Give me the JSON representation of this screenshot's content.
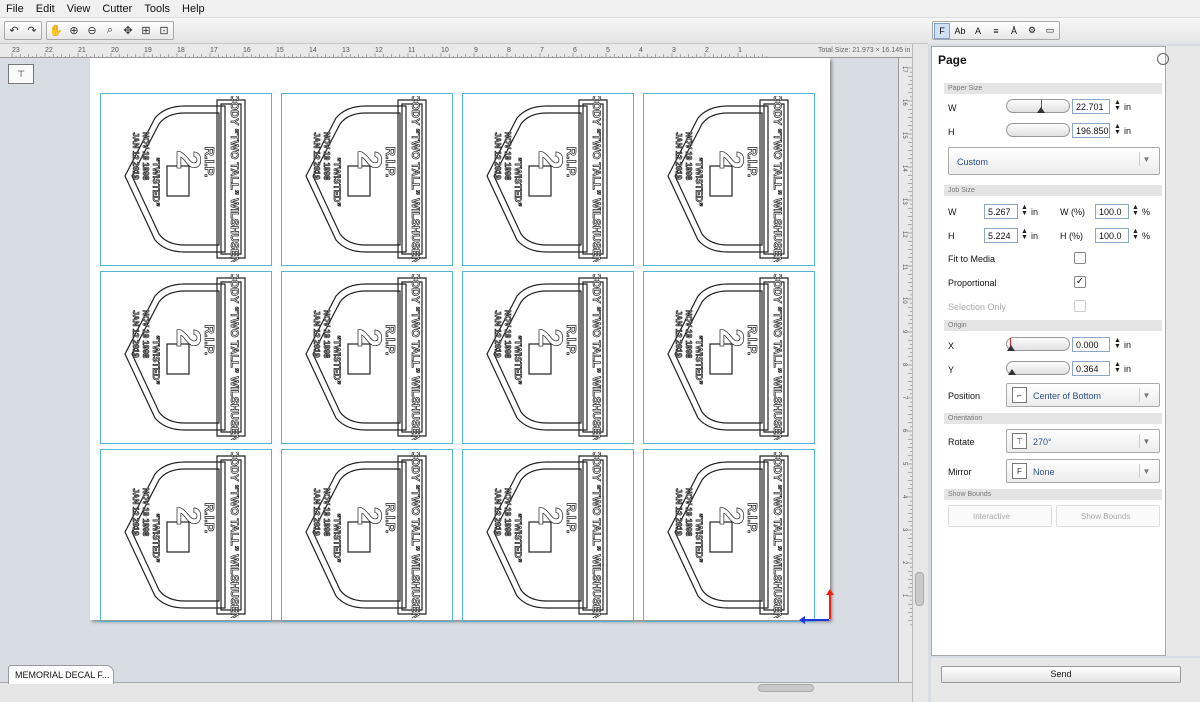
{
  "menu": [
    "File",
    "Edit",
    "View",
    "Cutter",
    "Tools",
    "Help"
  ],
  "toolbar": {
    "undo_redo": [
      "undo-icon",
      "redo-icon"
    ],
    "tools": [
      "hand-icon",
      "zoom-in-icon",
      "zoom-out-icon",
      "zoom-area-icon",
      "pan-icon",
      "fit-page-icon",
      "fit-selection-icon"
    ]
  },
  "ruler": {
    "labels": [
      "23",
      "22",
      "21",
      "20",
      "19",
      "18",
      "17",
      "16",
      "15",
      "14",
      "13",
      "12",
      "11",
      "10",
      "9",
      "8",
      "7",
      "6",
      "5",
      "4",
      "3",
      "2",
      "1"
    ],
    "total_size": "Total Size: 21.973 × 16.145 in",
    "vlabels": [
      "17",
      "16",
      "15",
      "14",
      "13",
      "12",
      "11",
      "10",
      "9",
      "8",
      "7",
      "6",
      "5",
      "4",
      "3",
      "2",
      "1"
    ]
  },
  "canvas": {
    "decal_lines": [
      "CODY “TWO TALL” WILSHUSEN",
      "R.I.P.",
      "“TWISTED”",
      "NOV 19 1998",
      "JAN 12 2019"
    ],
    "decal_number": "2",
    "rows": 3,
    "cols": 4
  },
  "doc_tab": "MEMORIAL DECAL F...",
  "panel_tabs": [
    "page-icon",
    "text-icon",
    "path-icon",
    "align-icon",
    "weld-icon",
    "settings-icon",
    "cutter-icon"
  ],
  "panel": {
    "title": "Page",
    "paper_size": {
      "section": "Paper Size",
      "w_label": "W",
      "w_value": "22.701",
      "w_unit": "in",
      "h_label": "H",
      "h_value": "196.850",
      "h_unit": "in",
      "preset": "Custom"
    },
    "job_size": {
      "section": "Job Size",
      "w_label": "W",
      "w_value": "5.267",
      "w_unit": "in",
      "wpct_label": "W (%)",
      "wpct_value": "100.0",
      "wpct_unit": "%",
      "h_label": "H",
      "h_value": "5.224",
      "h_unit": "in",
      "hpct_label": "H (%)",
      "hpct_value": "100.0",
      "hpct_unit": "%",
      "fit_to_media": "Fit to Media",
      "proportional": "Proportional",
      "selection_only": "Selection Only",
      "proportional_checked": true
    },
    "origin": {
      "section": "Origin",
      "x_label": "X",
      "x_value": "0.000",
      "x_unit": "in",
      "y_label": "Y",
      "y_value": "0.364",
      "y_unit": "in",
      "position_label": "Position",
      "position_value": "Center of Bottom"
    },
    "orientation": {
      "section": "Orientation",
      "rotate_label": "Rotate",
      "rotate_value": "270°",
      "mirror_label": "Mirror",
      "mirror_value": "None"
    },
    "show_bounds": {
      "section": "Show Bounds",
      "interactive": "Interactive",
      "show_bounds": "Show Bounds"
    },
    "send": "Send"
  }
}
